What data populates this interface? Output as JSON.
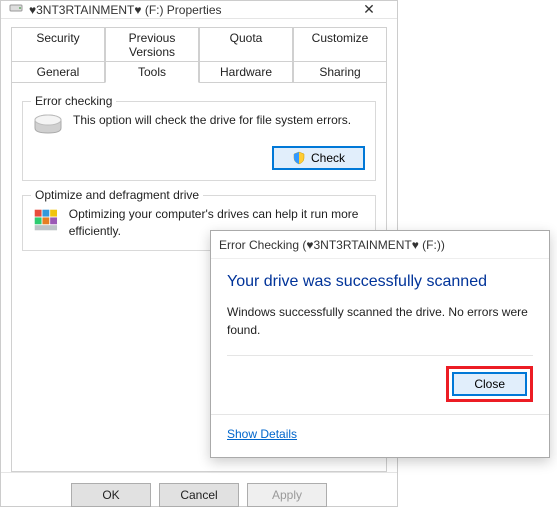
{
  "propertiesWindow": {
    "title": "♥3NT3RTAINMENT♥ (F:) Properties",
    "tabsRow1": [
      "Security",
      "Previous Versions",
      "Quota",
      "Customize"
    ],
    "tabsRow2": [
      "General",
      "Tools",
      "Hardware",
      "Sharing"
    ],
    "activeTab": "Tools",
    "errorChecking": {
      "groupTitle": "Error checking",
      "text": "This option will check the drive for file system errors.",
      "buttonLabel": "Check"
    },
    "optimize": {
      "groupTitle": "Optimize and defragment drive",
      "text": "Optimizing your computer's drives can help it run more efficiently."
    },
    "buttons": {
      "ok": "OK",
      "cancel": "Cancel",
      "apply": "Apply"
    }
  },
  "errorDialog": {
    "title": "Error Checking (♥3NT3RTAINMENT♥ (F:))",
    "heading": "Your drive was successfully scanned",
    "message": "Windows successfully scanned the drive. No errors were found.",
    "closeLabel": "Close",
    "showDetails": "Show Details"
  }
}
